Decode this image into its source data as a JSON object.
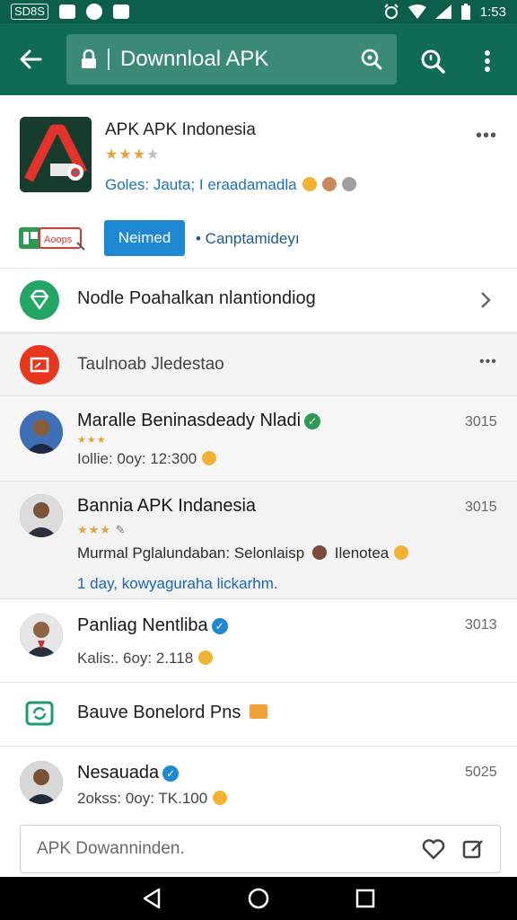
{
  "status_bar": {
    "carrier_label": "SD8S",
    "time": "1:53"
  },
  "toolbar": {
    "title": "Downnloal APK"
  },
  "app": {
    "name": "APK APK Indonesia",
    "rating_stars": 3,
    "rating_max": 4,
    "subtitle": "Goles: Jauta; I eraadamadla",
    "badge_label": "Aoops",
    "install_label": "Neimed",
    "compat_text": "• Canptamideyı"
  },
  "rows": {
    "mobile_title": "Nodle Poahalkan nlantiondiog",
    "section_title": "Taulnoab Jledestao"
  },
  "reviews": [
    {
      "name": "Maralle Beninasdeady Nladi",
      "count": "3015",
      "stars": "★★★",
      "meta": "Iollie: 0oy: 12:300",
      "badge_color": "#2e9b54"
    },
    {
      "name": "Bannia APK Indanesia",
      "count": "3015",
      "stars": "★★★",
      "text": "Murmal Pglalundaban: Selonlaisp",
      "text_tail": "Ilenotea",
      "link": "1 day, kowyaguraha lickarhm."
    },
    {
      "name": "Panliag Nentliba",
      "count": "3013",
      "meta": "Kalis:. 6oy: 2.118",
      "badge_color": "#1e88d3"
    },
    {
      "name": "Nesauada",
      "count": "5025",
      "meta": "2okss: 0oy: TK.100",
      "badge_color": "#1e88d3"
    }
  ],
  "promo": {
    "title": "Bauve Bonelord Pns"
  },
  "bottom_input": {
    "placeholder": "APK Dowanninden."
  },
  "colors": {
    "toolbar": "#0f6b55",
    "status": "#0b5e4a",
    "accent_blue": "#1e88d3",
    "star": "#e6a23c"
  }
}
